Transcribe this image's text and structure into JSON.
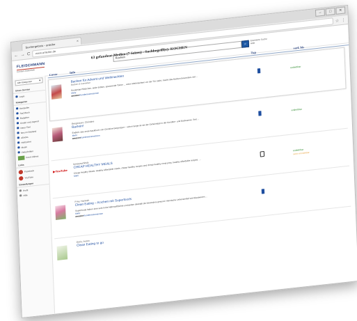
{
  "browser": {
    "tab_title": "Suchergebnis - onleihe",
    "tab_close": "×",
    "url": "www.onleihe.de",
    "nav_back": "←",
    "nav_forward": "→",
    "nav_reload": "C",
    "star": "☆",
    "menu": "⋮",
    "window_buttons": [
      "–",
      "□",
      "✕"
    ]
  },
  "header": {
    "logo_line1": "FLEISCHMANN",
    "logo_line2": "Content-Bibliothek",
    "search_value": "Kochen",
    "search_button": "⌕",
    "search_hint_1": "Erweiterte Suche",
    "search_hint_2": "Hilfe"
  },
  "sidebar": {
    "select_label": "Alle Kategorien",
    "select_arrow": "▾",
    "section1": "Unser Service",
    "section1_items": [
      "Login"
    ],
    "section2": "Kategorien",
    "section2_items": [
      "Bestseller",
      "Sachbuch",
      "Ratgeber",
      "Kinder und Jugend",
      "Neue Titel",
      "Neu im Bestand",
      "eBooks",
      "Hörbücher",
      "Musik",
      "Zeitschriften"
    ],
    "image_item": "Koch-Videos",
    "section3": "Links",
    "section3_items": [
      "Facebook",
      "YouTube"
    ],
    "section4": "Einstellungen",
    "section4_items": [
      "Profil",
      "Hilfe"
    ]
  },
  "results": {
    "summary": "63 gefundene Medien (7 Seiten) - Suchbegriff(e): KOCHEN",
    "col_cover": "Cover",
    "col_info": "Info",
    "col_type": "Typ",
    "col_avail": "verf. bis",
    "items": [
      {
        "author": "",
        "title": "Backen für Advent und Weihnachten",
        "subtitle": "Backen & Genießen",
        "desc": "Knusprige Plätzchen, süße Bröten, spannende Torten ... wenn Weihnachten vor der Tür steht, macht das Backen besonders viel ...",
        "more": "Mehr",
        "amazon": "amazon",
        "reviews": "Kundenrezensionen",
        "type_icon": "book-icon",
        "availability": "entleihbar",
        "availability2": ""
      },
      {
        "author": "Bergmayer, Christine",
        "title": "Backen!",
        "subtitle": "",
        "desc": "Endlich: das erste Backbuch von Christine Bergmayer – schon lange ist sie der Geheimtipp in der Konditor- und Backszene. Seit ...",
        "more": "Mehr",
        "amazon": "amazon",
        "reviews": "Kundenrezensionen",
        "type_icon": "book-icon",
        "availability": "entleihbar",
        "availability2": ""
      },
      {
        "author": "keepyourbitsly",
        "title": "CHEAP HEALTHY MEALS",
        "subtitle": "",
        "desc": "Cheap Healthy Meals: Healthy affordable meals, cheap healthy recipes and cheap healthy meal prep, healthy affordable recipes. ...",
        "more": "Mehr",
        "amazon": "",
        "reviews": "",
        "type_icon": "tablet-icon",
        "availability": "entleihbar",
        "availability2": "nicht vormerkbar"
      },
      {
        "author": "Frey, Hannah",
        "title": "Clean Eating – Kochen mit Superfoods",
        "subtitle": "",
        "desc": "Superfoods haben eine sehr hohe Nährstoffdichte und gelten deshalb als besonders gesund. Heimische Lebensmittel wie Blaubeeren ...",
        "more": "Mehr",
        "amazon": "amazon",
        "reviews": "Kundenrezensionen",
        "type_icon": "book-icon",
        "availability": "entleihbar",
        "availability2": ""
      },
      {
        "author": "Doris, Anton",
        "title": "Clean Eating to go",
        "subtitle": "",
        "desc": "",
        "more": "",
        "amazon": "",
        "reviews": "",
        "type_icon": "book-icon",
        "availability": "",
        "availability2": ""
      }
    ]
  },
  "colors": {
    "accent": "#1f4fa0",
    "available": "#2e8b2e",
    "warning": "#e8a33d",
    "brand_red": "#c0392b"
  }
}
